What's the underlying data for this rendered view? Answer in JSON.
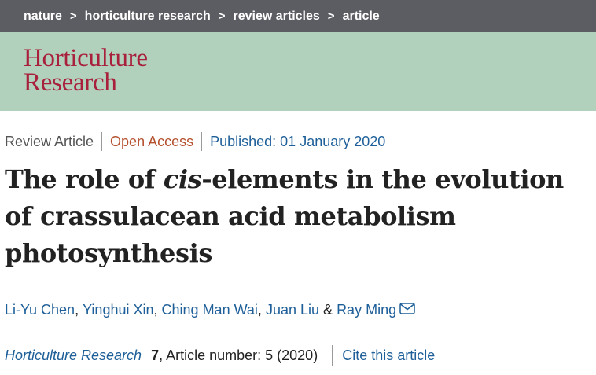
{
  "breadcrumb": {
    "items": [
      "nature",
      "horticulture research",
      "review articles",
      "article"
    ],
    "separator": ">"
  },
  "journal_logo": {
    "line1": "Horticulture",
    "line2": "Research"
  },
  "meta": {
    "type": "Review Article",
    "access": "Open Access",
    "published": "Published: 01 January 2020"
  },
  "title": {
    "part1": "The role of ",
    "italic": "cis",
    "part2": "-elements in the evolution of crassulacean acid metabolism photosynthesis"
  },
  "authors": {
    "list": [
      "Li-Yu Chen",
      "Yinghui Xin",
      "Ching Man Wai",
      "Juan Liu",
      "Ray Ming"
    ],
    "comma": ",",
    "ampersand": "&"
  },
  "citation": {
    "journal": "Horticulture Research",
    "volume": "7",
    "article_number": ", Article number: 5 (2020)",
    "cite_link": "Cite this article"
  },
  "colors": {
    "breadcrumb_bg": "#5c5d63",
    "banner_bg": "#b2d1bd",
    "logo": "#a8203c",
    "link": "#1e5f99",
    "open_access": "#b5502e"
  }
}
